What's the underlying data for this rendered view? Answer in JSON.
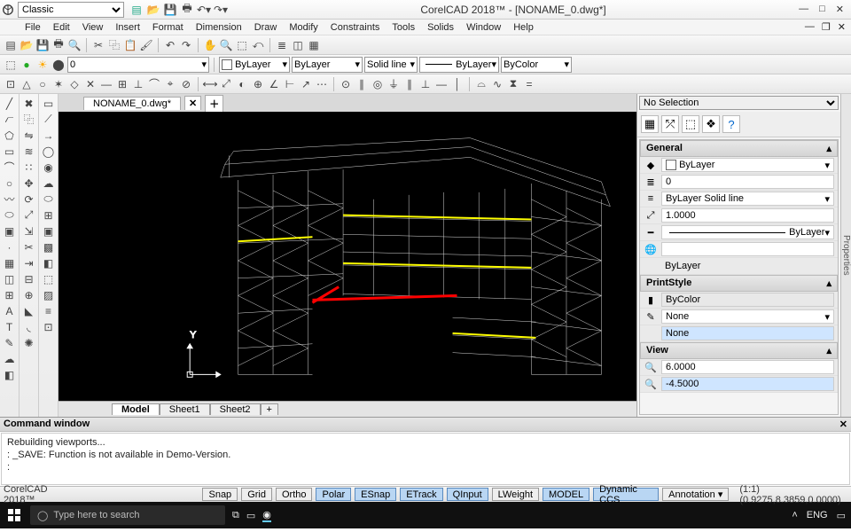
{
  "title": "CorelCAD 2018™ - [NONAME_0.dwg*]",
  "workspace": "Classic",
  "menus": [
    "File",
    "Edit",
    "View",
    "Insert",
    "Format",
    "Dimension",
    "Draw",
    "Modify",
    "Constraints",
    "Tools",
    "Solids",
    "Window",
    "Help"
  ],
  "layerbar": {
    "layer": "0",
    "per": "ByLayer",
    "style": "Solid line",
    "linetype": "ByLayer",
    "color": "ByColor"
  },
  "doc_tab": "NONAME_0.dwg*",
  "bottom_tabs": [
    "Model",
    "Sheet1",
    "Sheet2"
  ],
  "props": {
    "selection": "No Selection",
    "sections": {
      "general": "General",
      "printstyle": "PrintStyle",
      "view": "View"
    },
    "general": {
      "color": "ByLayer",
      "layer": "0",
      "ltype": "ByLayer   Solid line",
      "scale": "1.0000",
      "lweight": "ByLayer",
      "thick": "",
      "plotcolor": "ByLayer"
    },
    "printstyle": {
      "mode": "ByColor",
      "style": "None",
      "table": "None"
    },
    "view": {
      "x": "6.0000",
      "y": "-4.5000"
    }
  },
  "cmd": {
    "title": "Command window",
    "lines": [
      "Rebuilding viewports...",
      "",
      ": _SAVE: Function is not available in Demo-Version.",
      ":"
    ]
  },
  "status": {
    "app": "CorelCAD 2018™",
    "buttons": [
      "Snap",
      "Grid",
      "Ortho",
      "Polar",
      "ESnap",
      "ETrack",
      "QInput",
      "LWeight",
      "MODEL",
      "Dynamic CCS"
    ],
    "active": [
      "Polar",
      "ESnap",
      "ETrack",
      "QInput",
      "MODEL",
      "Dynamic CCS"
    ],
    "annotation": "Annotation",
    "coords": "(1:1)   (0.9275,8.3859,0.0000)"
  },
  "taskbar": {
    "search_placeholder": "Type here to search",
    "lang": "ENG"
  },
  "vert_label": "Properties"
}
